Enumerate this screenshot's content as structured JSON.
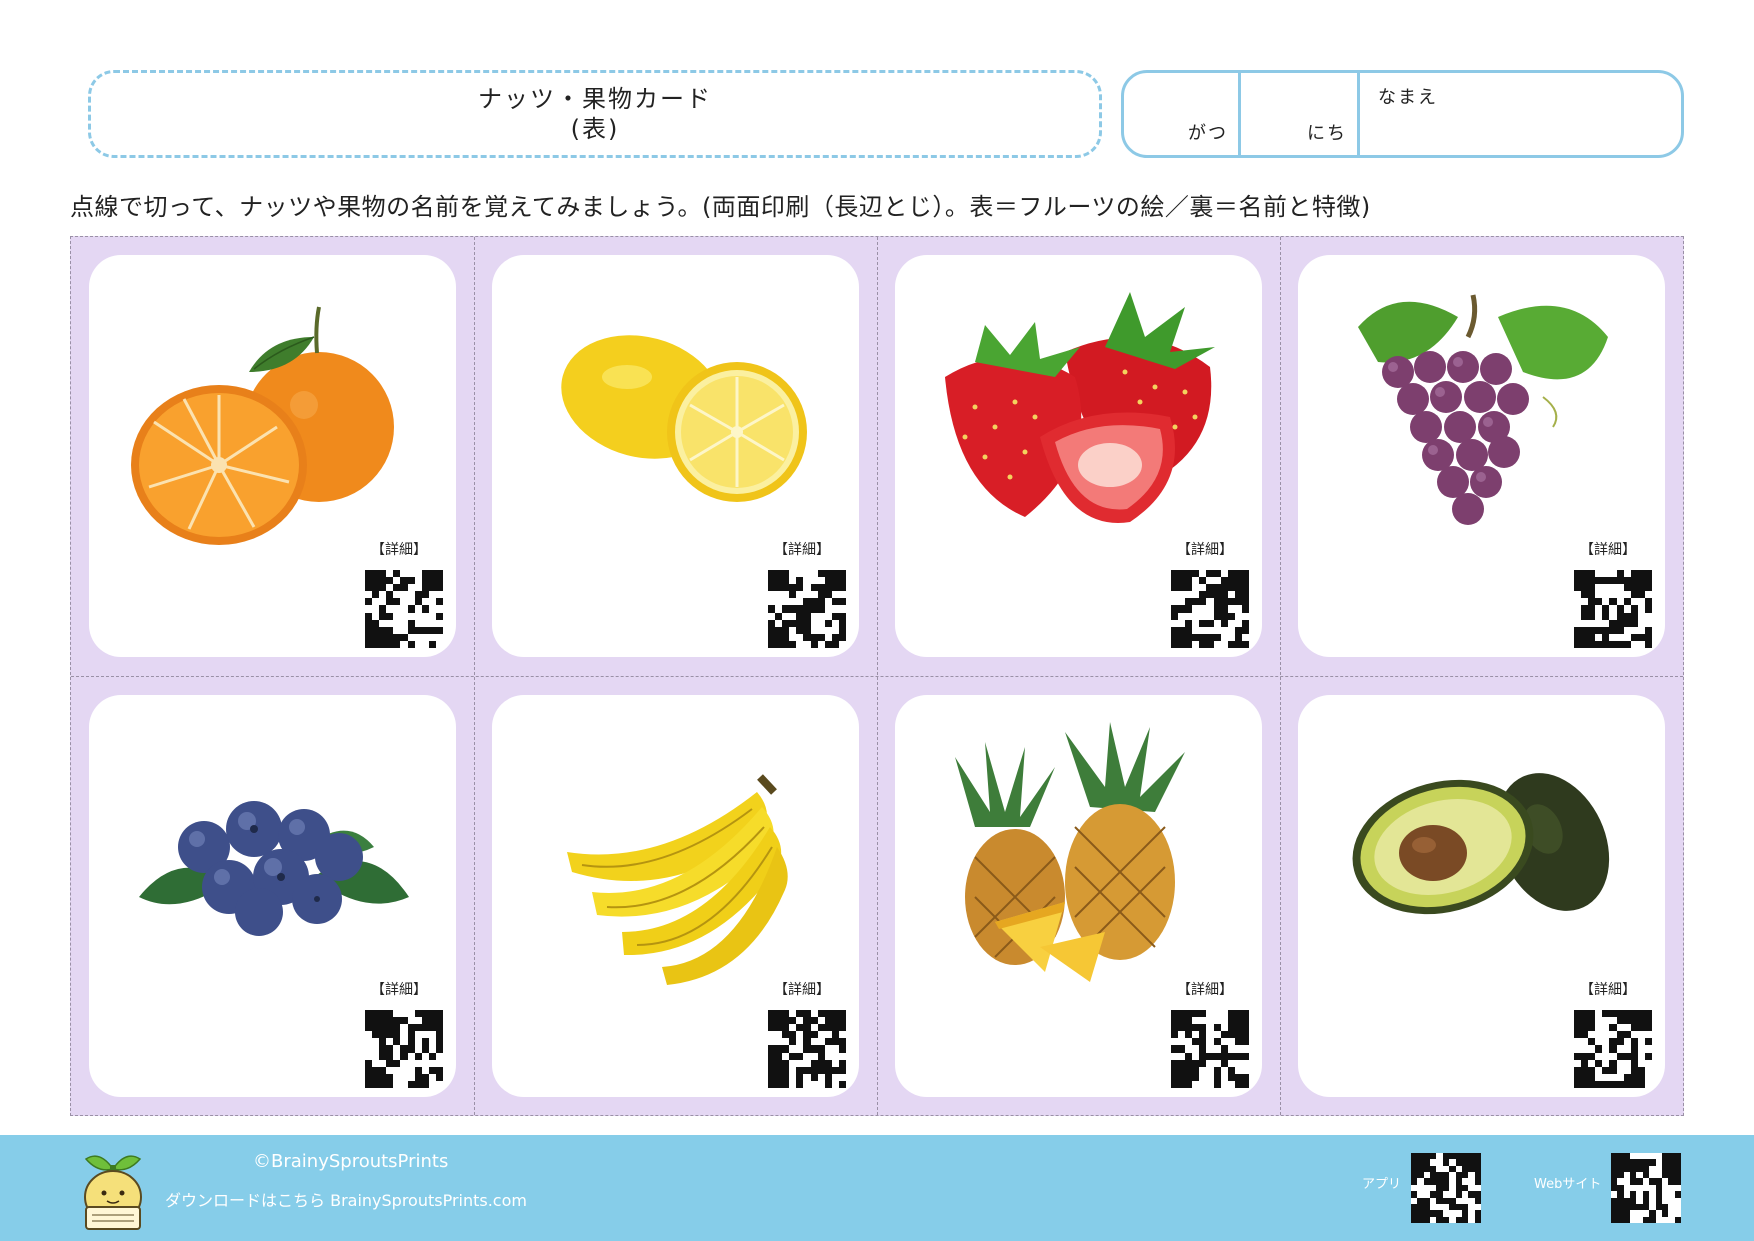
{
  "header": {
    "title_line1": "ナッツ・果物カード",
    "title_line2": "(表)",
    "month_label": "がつ",
    "day_label": "にち",
    "name_label": "なまえ"
  },
  "instruction": "点線で切って、ナッツや果物の名前を覚えてみましょう。(両面印刷（長辺とじ）。表＝フルーツの絵／裏＝名前と特徴)",
  "cards": [
    {
      "fruit": "tangerine-image",
      "detail_label": "【詳細】"
    },
    {
      "fruit": "lemon-image",
      "detail_label": "【詳細】"
    },
    {
      "fruit": "strawberry-image",
      "detail_label": "【詳細】"
    },
    {
      "fruit": "grape-image",
      "detail_label": "【詳細】"
    },
    {
      "fruit": "blueberry-image",
      "detail_label": "【詳細】"
    },
    {
      "fruit": "banana-image",
      "detail_label": "【詳細】"
    },
    {
      "fruit": "pineapple-image",
      "detail_label": "【詳細】"
    },
    {
      "fruit": "avocado-image",
      "detail_label": "【詳細】"
    }
  ],
  "footer": {
    "copyright": "©BrainySproutsPrints",
    "download": "ダウンロードはこちら BrainySproutsPrints.com",
    "app_label": "アプリ",
    "web_label": "Webサイト"
  },
  "colors": {
    "accent_blue": "#86cde9",
    "border_blue": "#8dc9e6",
    "card_background": "#e4d7f3"
  }
}
